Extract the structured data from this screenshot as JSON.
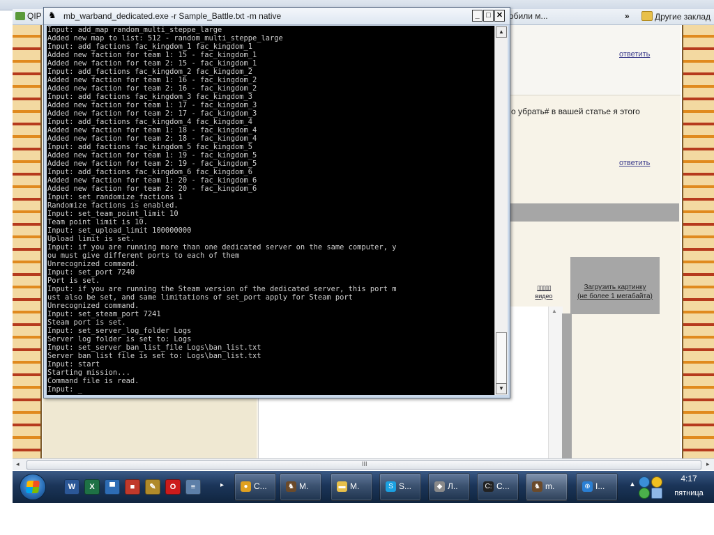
{
  "browser": {
    "address": "mb_warband_dedicated.exe",
    "bookmarks": [
      {
        "label": "QIP",
        "color": "#5a9a3a"
      },
      {
        "label": "обили м...",
        "color": ""
      },
      {
        "label": "Другие заклад",
        "color": "#e8c04a"
      }
    ],
    "more_bookmarks": "»"
  },
  "page": {
    "reply_links": [
      "ответить",
      "ответить"
    ],
    "comment_text": "о убрать# в вашей статье я этого",
    "upload_link_line1": "Загрузить картинку",
    "upload_link_line2": "(не более 1 мегабайта)",
    "video_icon": "▯▯▯▯▯",
    "video_label": "видео",
    "scroll_grip": "III"
  },
  "console": {
    "title": "mb_warband_dedicated.exe -r Sample_Battle.txt -m native",
    "buttons": {
      "minimize": "_",
      "maximize": "□",
      "close": "✕"
    },
    "lines": [
      "Input: add_map random_multi_steppe_large",
      "Added new map to list: 512 - random_multi_steppe_large",
      "Input: add_factions fac_kingdom_1 fac_kingdom_1",
      "Added new faction for team 1: 15 - fac_kingdom_1",
      "Added new faction for team 2: 15 - fac_kingdom_1",
      "Input: add_factions fac_kingdom_2 fac_kingdom_2",
      "Added new faction for team 1: 16 - fac_kingdom_2",
      "Added new faction for team 2: 16 - fac_kingdom_2",
      "Input: add_factions fac_kingdom_3 fac_kingdom_3",
      "Added new faction for team 1: 17 - fac_kingdom_3",
      "Added new faction for team 2: 17 - fac_kingdom_3",
      "Input: add_factions fac_kingdom_4 fac_kingdom_4",
      "Added new faction for team 1: 18 - fac_kingdom_4",
      "Added new faction for team 2: 18 - fac_kingdom_4",
      "Input: add_factions fac_kingdom_5 fac_kingdom_5",
      "Added new faction for team 1: 19 - fac_kingdom_5",
      "Added new faction for team 2: 19 - fac_kingdom_5",
      "Input: add_factions fac_kingdom_6 fac_kingdom_6",
      "Added new faction for team 1: 20 - fac_kingdom_6",
      "Added new faction for team 2: 20 - fac_kingdom_6",
      "Input: set_randomize_factions 1",
      "Randomize factions is enabled.",
      "Input: set_team_point_limit 10",
      "Team point limit is 10.",
      "Input: set_upload_limit 100000000",
      "Upload limit is set.",
      "Input: if you are running more than one dedicated server on the same computer, y",
      "ou must give different ports to each of them",
      "Unrecognized command.",
      "Input: set_port 7240",
      "Port is set.",
      "Input: if you are running the Steam version of the dedicated server, this port m",
      "ust also be set, and same limitations of set_port apply for Steam port",
      "Unrecognized command.",
      "Input: set_steam_port 7241",
      "Steam port is set.",
      "Input: set_server_log_folder Logs",
      "Server log folder is set to: Logs",
      "Input: set_server_ban_list_file Logs\\ban_list.txt",
      "Server ban list file is set to: Logs\\ban_list.txt",
      "Input: start",
      "Starting mission...",
      "Command file is read.",
      "Input: _"
    ]
  },
  "taskbar": {
    "quick_launch": [
      {
        "icon": "word-icon",
        "glyph": "W",
        "color": "#2b5797"
      },
      {
        "icon": "excel-icon",
        "glyph": "X",
        "color": "#1e7145"
      },
      {
        "icon": "desktop-icon",
        "glyph": "▀",
        "color": "#2d6cb5"
      },
      {
        "icon": "store-icon",
        "glyph": "■",
        "color": "#c0392b"
      },
      {
        "icon": "pen-icon",
        "glyph": "✎",
        "color": "#b08a2a"
      },
      {
        "icon": "opera-icon",
        "glyph": "O",
        "color": "#cc1b1b"
      },
      {
        "icon": "notepad-icon",
        "glyph": "≡",
        "color": "#5d7fa8"
      }
    ],
    "expand": "▸",
    "tasks": [
      {
        "label": "C...",
        "icon": "chrome-icon",
        "glyph": "●",
        "color": "#e0a020",
        "active": false
      },
      {
        "label": "M.",
        "icon": "warband-icon",
        "glyph": "♞",
        "color": "#6b4a2a",
        "active": false
      },
      {
        "label": "M.",
        "icon": "folder-icon",
        "glyph": "▬",
        "color": "#e8c04a",
        "active": false
      },
      {
        "label": "S...",
        "icon": "skype-icon",
        "glyph": "S",
        "color": "#1ba1e2",
        "active": false
      },
      {
        "label": "Л..",
        "icon": "app-icon",
        "glyph": "◆",
        "color": "#8a8a8a",
        "active": false
      },
      {
        "label": "C...",
        "icon": "cmd-icon",
        "glyph": "C:",
        "color": "#222222",
        "active": false
      },
      {
        "label": "m.",
        "icon": "warband-icon",
        "glyph": "♞",
        "color": "#6b4a2a",
        "active": true
      },
      {
        "label": "I...",
        "icon": "network-icon",
        "glyph": "⊕",
        "color": "#2a7fd4",
        "active": false
      }
    ],
    "tray_arrow": "▲",
    "time": "4:17",
    "day": "пятница"
  }
}
